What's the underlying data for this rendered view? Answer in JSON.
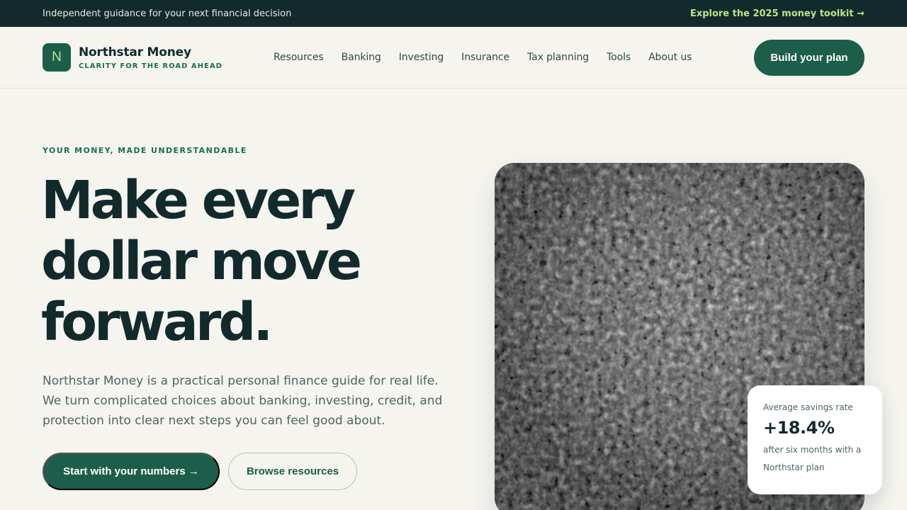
{
  "announcement": {
    "message": "Independent guidance for your next financial decision",
    "link": "Explore the 2025 money toolkit →"
  },
  "brand": {
    "mark": "N",
    "name": "Northstar Money",
    "tagline": "CLARITY FOR THE ROAD AHEAD"
  },
  "nav": {
    "items": [
      {
        "label": "Resources"
      },
      {
        "label": "Banking"
      },
      {
        "label": "Investing"
      },
      {
        "label": "Insurance"
      },
      {
        "label": "Tax planning"
      },
      {
        "label": "Tools"
      },
      {
        "label": "About us"
      }
    ],
    "cta": "Build your plan"
  },
  "hero": {
    "eyebrow": "YOUR MONEY, MADE UNDERSTANDABLE",
    "headline_lines": [
      "Make every",
      "dollar move",
      "forward."
    ],
    "lede": "Northstar Money is a practical personal finance guide for real life. We turn complicated choices about banking, investing, credit, and protection into clear next steps you can feel good about.",
    "primary_button": "Start with your numbers →",
    "secondary_button": "Browse resources"
  },
  "stat_card": {
    "label": "Average savings rate",
    "value": "+18.4%",
    "note": "after six months with a Northstar plan"
  },
  "colors": {
    "accent": "#1d5e4a",
    "dark": "#122a2c",
    "highlight": "#b9e58a",
    "background": "#f5f4ef"
  }
}
